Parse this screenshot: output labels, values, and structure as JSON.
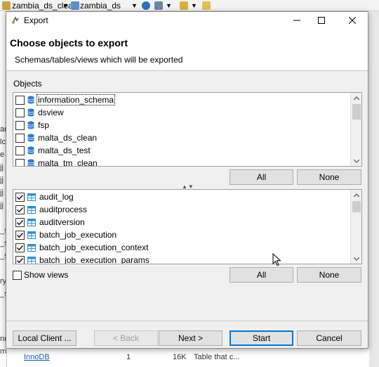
{
  "background": {
    "toolbar": {
      "combo1": "zambia_ds_clean",
      "combo2": "zambia_ds"
    },
    "left_fragments": [
      "am",
      "lc",
      "e",
      "jj",
      "jj",
      "jj",
      "jj",
      "_s",
      "_s",
      "_s",
      "ry",
      "_s",
      "nrec",
      "mp"
    ],
    "bottom": {
      "link1": "InnoDB",
      "num": "1",
      "size": "16K",
      "comment": "Table that c..."
    }
  },
  "dialog": {
    "title": "Export",
    "header": {
      "title": "Choose objects to export",
      "subtitle": "Schemas/tables/views which will be exported"
    },
    "objects_label": "Objects",
    "schemas": [
      {
        "label": "information_schema",
        "checked": false
      },
      {
        "label": "dsview",
        "checked": false
      },
      {
        "label": "fsp",
        "checked": false
      },
      {
        "label": "malta_ds_clean",
        "checked": false
      },
      {
        "label": "malta_ds_test",
        "checked": false
      },
      {
        "label": "malta_tm_clean",
        "checked": false
      }
    ],
    "tables": [
      {
        "label": "audit_log",
        "checked": true
      },
      {
        "label": "auditprocess",
        "checked": true
      },
      {
        "label": "auditversion",
        "checked": true
      },
      {
        "label": "batch_job_execution",
        "checked": true
      },
      {
        "label": "batch_job_execution_context",
        "checked": true
      },
      {
        "label": "batch_job_execution_params",
        "checked": true
      }
    ],
    "buttons": {
      "schemas_all": "All",
      "schemas_none": "None",
      "tables_all": "All",
      "tables_none": "None",
      "local_client": "Local Client ...",
      "back": "< Back",
      "next": "Next >",
      "start": "Start",
      "cancel": "Cancel"
    },
    "show_views_label": "Show views",
    "show_views_checked": false,
    "colors": {
      "accent": "#0078d7",
      "schema_icon": "#2b7bd1",
      "table_icon": "#2b8fd6"
    }
  }
}
